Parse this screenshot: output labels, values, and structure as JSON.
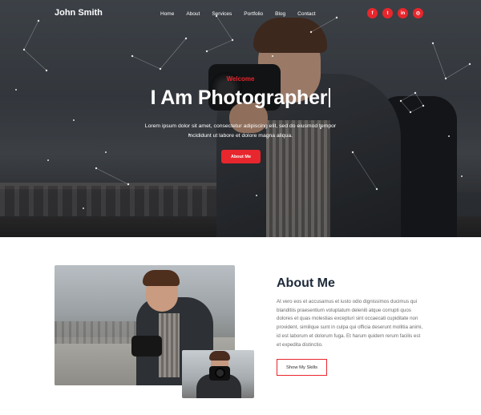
{
  "brand": {
    "name": "John Smith"
  },
  "nav": {
    "items": [
      {
        "label": "Home"
      },
      {
        "label": "About"
      },
      {
        "label": "Services"
      },
      {
        "label": "Portfolio"
      },
      {
        "label": "Blog"
      },
      {
        "label": "Contact"
      }
    ]
  },
  "social": {
    "items": [
      {
        "icon": "facebook-icon",
        "glyph": "f"
      },
      {
        "icon": "twitter-icon",
        "glyph": "t"
      },
      {
        "icon": "linkedin-icon",
        "glyph": "in"
      },
      {
        "icon": "instagram-icon",
        "glyph": "◎"
      }
    ],
    "color": "#e8262d"
  },
  "hero": {
    "kicker": "Welcome",
    "title": "I Am Photographer",
    "description": "Lorem ipsum dolor sit amet, consectetur adipiscing elit, sed do eiusmod tempor incididunt ut labore et dolore magna aliqua.",
    "button_label": "About Me"
  },
  "about": {
    "title": "About Me",
    "text": "At vero eos et accusamus et iusto odio dignissimos ducimus qui blanditiis praesentium voluptatum deleniti atque corrupti quos dolores et quas molestias excepturi sint occaecati cupiditate non provident, similique sunt in culpa qui officia deserunt mollitia animi, id est laborum et dolorum fuga. Et harum quidem rerum facilis est et expedita distinctio.",
    "button_label": "Show My Skills"
  },
  "colors": {
    "accent": "#e8262d",
    "heading": "#1e2a3a"
  }
}
